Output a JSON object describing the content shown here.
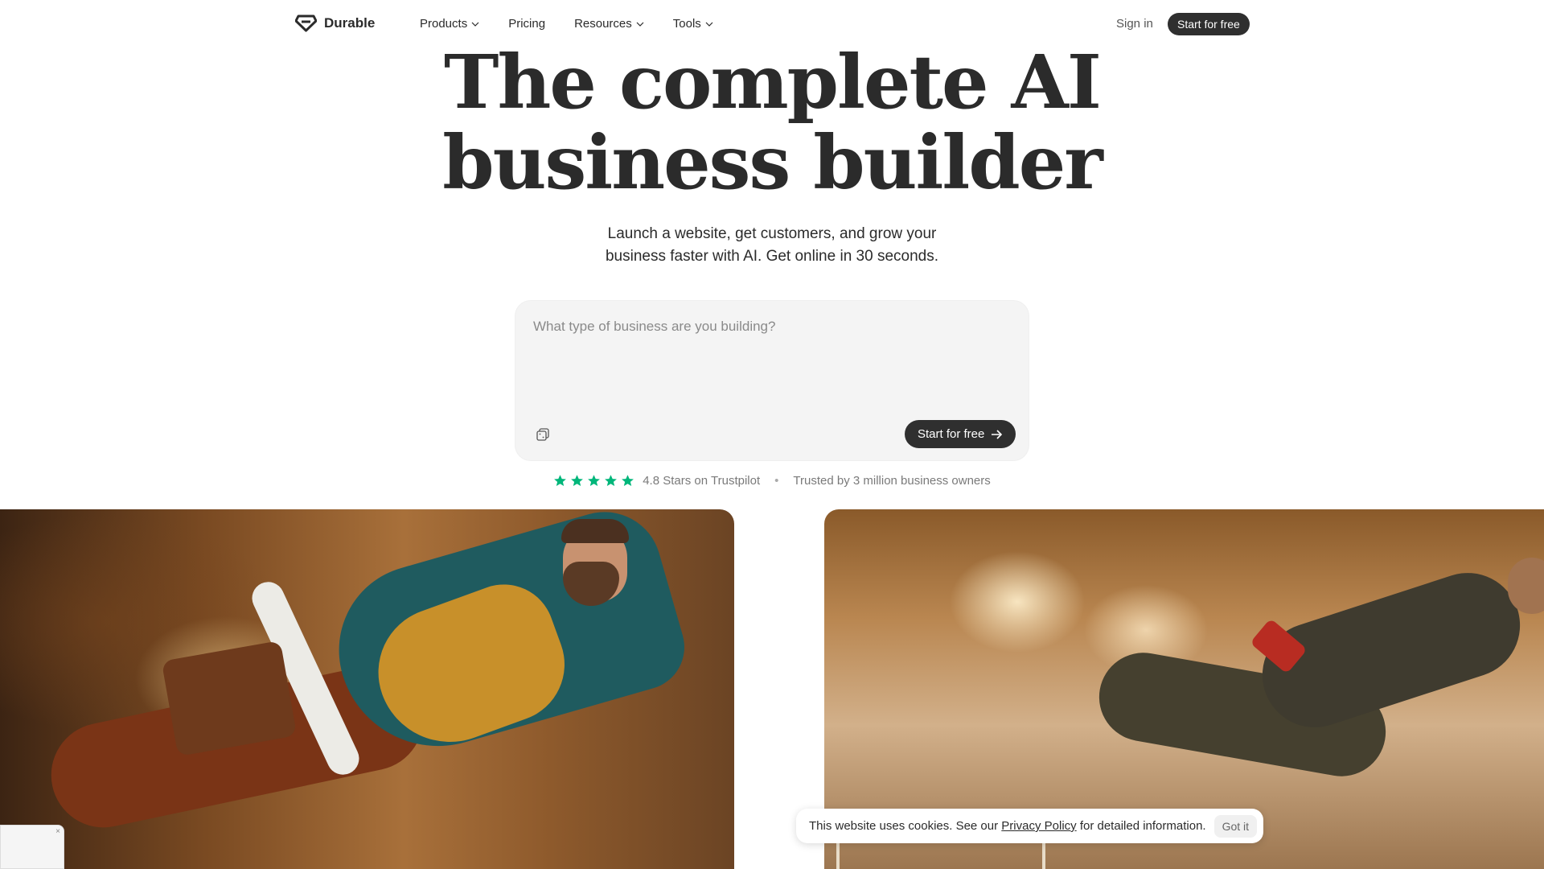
{
  "nav": {
    "brand": "Durable",
    "links": [
      {
        "label": "Products",
        "has_dropdown": true
      },
      {
        "label": "Pricing",
        "has_dropdown": false
      },
      {
        "label": "Resources",
        "has_dropdown": true
      },
      {
        "label": "Tools",
        "has_dropdown": true
      }
    ],
    "signin": "Sign in",
    "cta": "Start for free"
  },
  "hero": {
    "title_line1": "The complete AI",
    "title_line2": "business builder",
    "subtitle_line1": "Launch a website, get customers, and grow your",
    "subtitle_line2": "business faster with AI. Get online in 30 seconds."
  },
  "prompt": {
    "placeholder": "What type of business are you building?",
    "value": "",
    "cta": "Start for free",
    "icon": "dice-icon"
  },
  "rating": {
    "stars": 5,
    "score_text": "4.8 Stars on Trustpilot",
    "separator": "•",
    "trusted_text": "Trusted by 3 million business owners",
    "star_color": "#00b67a"
  },
  "cookie": {
    "text_before": "This website uses cookies. See our ",
    "link": "Privacy Policy",
    "text_after": " for detailed information.",
    "button": "Got it"
  },
  "mini_widget": {
    "close_label": "×"
  },
  "colors": {
    "accent_dark": "#2f2f2f",
    "text": "#2b2b2b",
    "muted": "#7a7a7a",
    "prompt_bg": "#f4f4f4"
  }
}
